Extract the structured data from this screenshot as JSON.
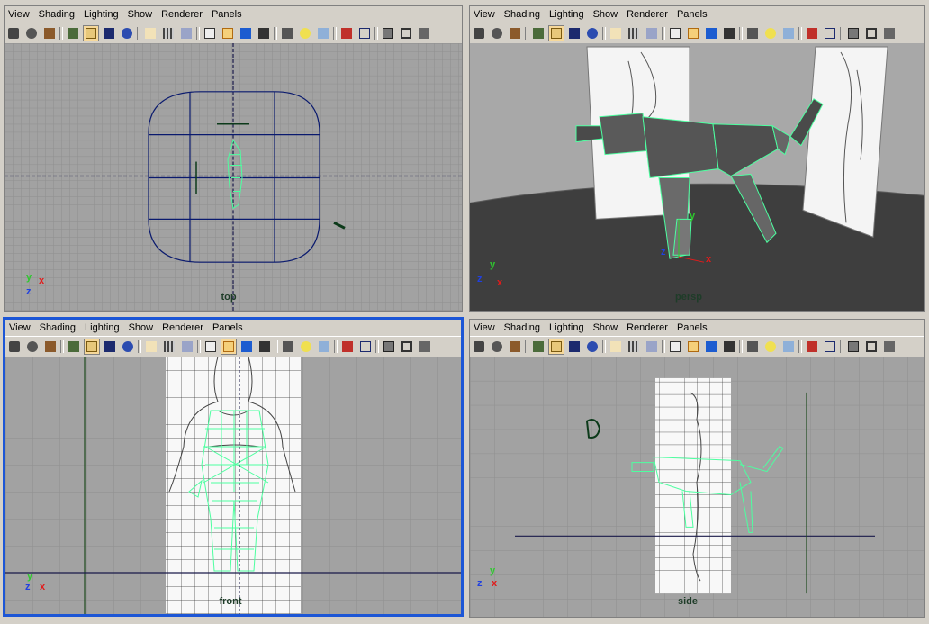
{
  "menu": [
    "View",
    "Shading",
    "Lighting",
    "Show",
    "Renderer",
    "Panels"
  ],
  "toolbar_icons": [
    "camera-select-icon",
    "camera-attributes-icon",
    "bookmark-icon",
    "image-plane-icon",
    "grid-toggle-icon",
    "film-gate-icon",
    "resolution-gate-icon",
    "safe-action-icon",
    "field-chart-icon",
    "safe-title-icon",
    "text-overlay-icon",
    "wireframe-icon",
    "smooth-shade-icon",
    "flat-shade-icon",
    "bounding-box-icon",
    "use-lights-icon",
    "shadows-icon",
    "textured-icon",
    "isolate-select-icon",
    "xray-icon",
    "backface-icon",
    "more-icon"
  ],
  "panels": {
    "top": {
      "label": "top",
      "axis": {
        "y": "y",
        "x": "x",
        "z": "z"
      }
    },
    "persp": {
      "label": "persp",
      "axis": {
        "y": "y",
        "x": "x",
        "z": "z"
      },
      "local_axis": {
        "y": "y",
        "x": "x",
        "z": "z"
      }
    },
    "front": {
      "label": "front",
      "axis": {
        "y": "y",
        "x": "x",
        "z": "z"
      }
    },
    "side": {
      "label": "side",
      "axis": {
        "y": "y",
        "x": "x",
        "z": "z"
      }
    }
  },
  "colors": {
    "grid_bg": "#a2a2a2",
    "grid_line": "#8f8f8f",
    "wire": "#4dffa0",
    "active_border": "#1c56d6",
    "nurbs": "#0a1a6e",
    "axis_dark": "#1a1a4a"
  }
}
